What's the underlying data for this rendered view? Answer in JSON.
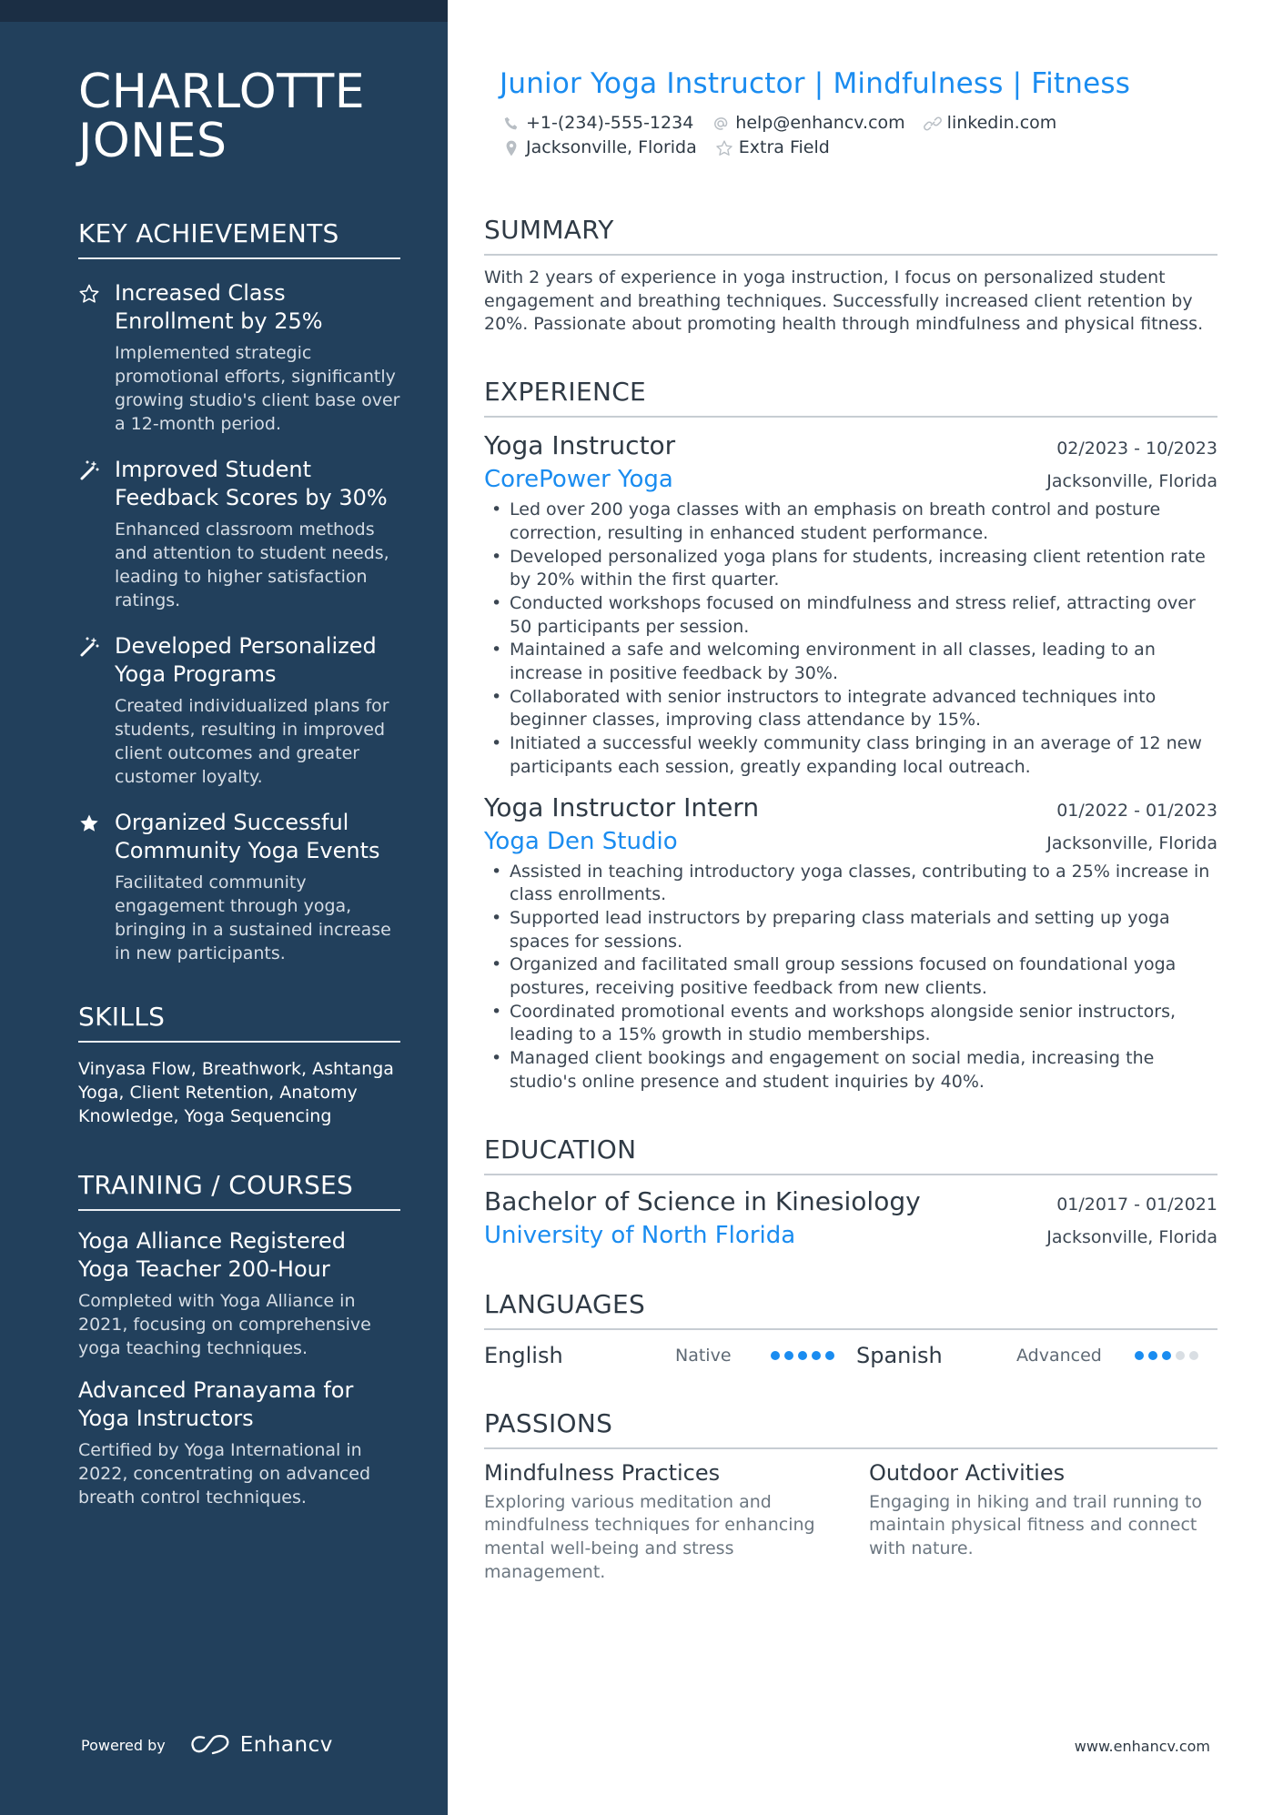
{
  "sidebar": {
    "name_line1": "CHARLOTTE",
    "name_line2": "JONES",
    "achievements_heading": "KEY ACHIEVEMENTS",
    "achievements": [
      {
        "icon": "star-outline-icon",
        "title": "Increased Class Enrollment by 25%",
        "desc": "Implemented strategic promotional efforts, significantly growing studio's client base over a 12-month period."
      },
      {
        "icon": "magic-wand-icon",
        "title": "Improved Student Feedback Scores by 30%",
        "desc": "Enhanced classroom methods and attention to student needs, leading to higher satisfaction ratings."
      },
      {
        "icon": "magic-wand-icon",
        "title": "Developed Personalized Yoga Programs",
        "desc": "Created individualized plans for students, resulting in improved client outcomes and greater customer loyalty."
      },
      {
        "icon": "star-filled-icon",
        "title": "Organized Successful Community Yoga Events",
        "desc": "Facilitated community engagement through yoga, bringing in a sustained increase in new participants."
      }
    ],
    "skills_heading": "SKILLS",
    "skills_text": "Vinyasa Flow, Breathwork, Ashtanga Yoga, Client Retention, Anatomy Knowledge, Yoga Sequencing",
    "training_heading": "TRAINING / COURSES",
    "courses": [
      {
        "title": "Yoga Alliance Registered Yoga Teacher 200-Hour",
        "desc": "Completed with Yoga Alliance in 2021, focusing on comprehensive yoga teaching techniques."
      },
      {
        "title": "Advanced Pranayama for Yoga Instructors",
        "desc": "Certified by Yoga International in 2022, concentrating on advanced breath control techniques."
      }
    ],
    "powered_by": "Powered by",
    "brand_name": "Enhancv"
  },
  "header": {
    "headline": "Junior Yoga Instructor | Mindfulness | Fitness",
    "phone": "+1-(234)-555-1234",
    "email": "help@enhancv.com",
    "linkedin": "linkedin.com",
    "location": "Jacksonville, Florida",
    "extra": "Extra Field"
  },
  "summary": {
    "heading": "SUMMARY",
    "text": "With 2 years of experience in yoga instruction, I focus on personalized student engagement and breathing techniques. Successfully increased client retention by 20%. Passionate about promoting health through mindfulness and physical fitness."
  },
  "experience": {
    "heading": "EXPERIENCE",
    "jobs": [
      {
        "title": "Yoga Instructor",
        "dates": "02/2023 - 10/2023",
        "company": "CorePower Yoga",
        "location": "Jacksonville, Florida",
        "bullets": [
          "Led over 200 yoga classes with an emphasis on breath control and posture correction, resulting in enhanced student performance.",
          "Developed personalized yoga plans for students, increasing client retention rate by 20% within the first quarter.",
          "Conducted workshops focused on mindfulness and stress relief, attracting over 50 participants per session.",
          "Maintained a safe and welcoming environment in all classes, leading to an increase in positive feedback by 30%.",
          "Collaborated with senior instructors to integrate advanced techniques into beginner classes, improving class attendance by 15%.",
          "Initiated a successful weekly community class bringing in an average of 12 new participants each session, greatly expanding local outreach."
        ]
      },
      {
        "title": "Yoga Instructor Intern",
        "dates": "01/2022 - 01/2023",
        "company": "Yoga Den Studio",
        "location": "Jacksonville, Florida",
        "bullets": [
          "Assisted in teaching introductory yoga classes, contributing to a 25% increase in class enrollments.",
          "Supported lead instructors by preparing class materials and setting up yoga spaces for sessions.",
          "Organized and facilitated small group sessions focused on foundational yoga postures, receiving positive feedback from new clients.",
          "Coordinated promotional events and workshops alongside senior instructors, leading to a 15% growth in studio memberships.",
          "Managed client bookings and engagement on social media, increasing the studio's online presence and student inquiries by 40%."
        ]
      }
    ]
  },
  "education": {
    "heading": "EDUCATION",
    "degree": "Bachelor of Science in Kinesiology",
    "dates": "01/2017 - 01/2021",
    "school": "University of North Florida",
    "location": "Jacksonville, Florida"
  },
  "languages": {
    "heading": "LANGUAGES",
    "items": [
      {
        "name": "English",
        "level": "Native",
        "rating": 5,
        "max": 5
      },
      {
        "name": "Spanish",
        "level": "Advanced",
        "rating": 3,
        "max": 5
      }
    ]
  },
  "passions": {
    "heading": "PASSIONS",
    "items": [
      {
        "title": "Mindfulness Practices",
        "desc": "Exploring various meditation and mindfulness techniques for enhancing mental well-being and stress management."
      },
      {
        "title": "Outdoor Activities",
        "desc": "Engaging in hiking and trail running to maintain physical fitness and connect with nature."
      }
    ]
  },
  "footer": {
    "url": "www.enhancv.com"
  },
  "colors": {
    "sidebar": "#22405c",
    "accent": "#1a8cf0"
  }
}
